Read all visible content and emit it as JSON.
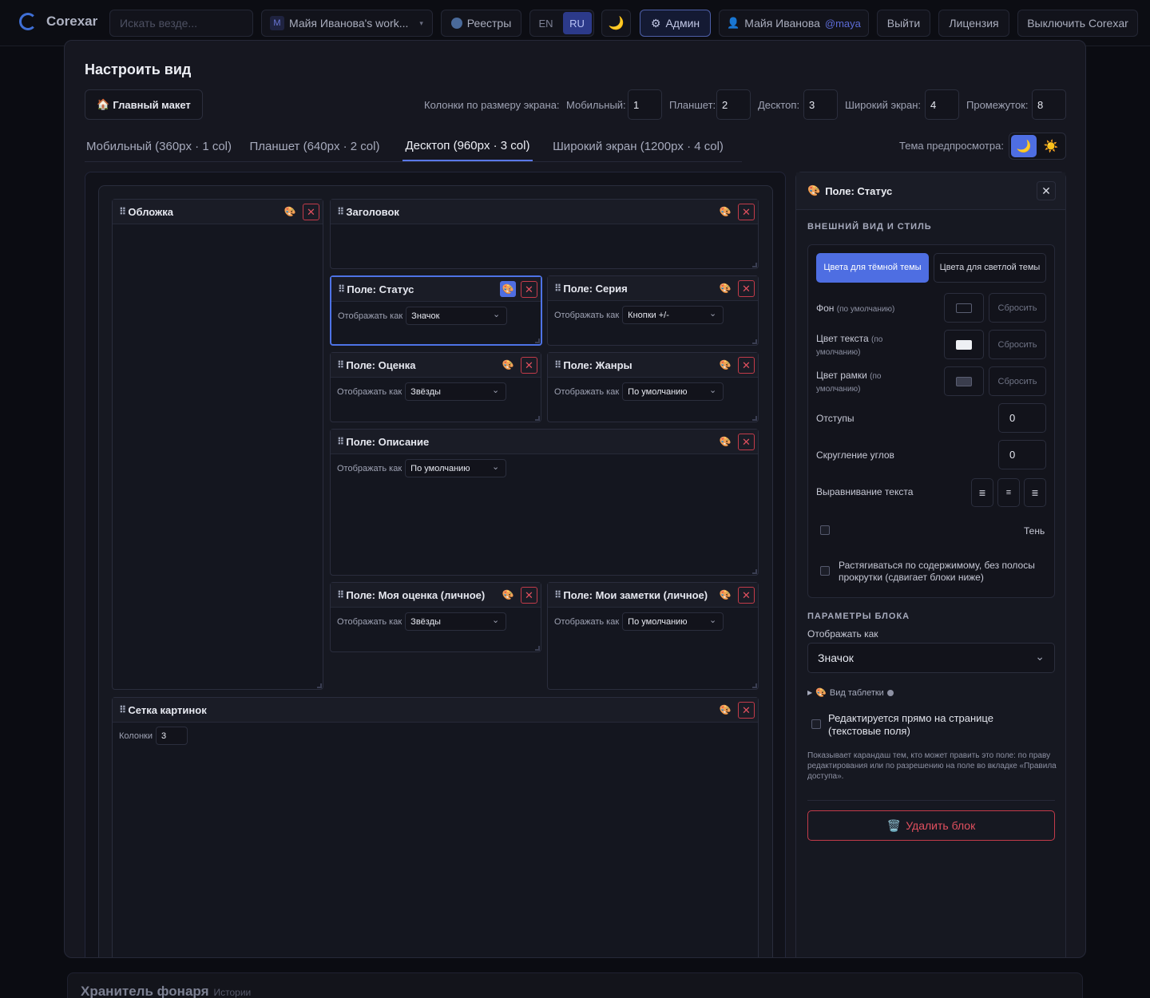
{
  "nav": {
    "brand": "Corexar",
    "search_placeholder": "Искать везде...",
    "workspace_initial": "M",
    "workspace": "Майя Иванова's work...",
    "registries": "Реестры",
    "lang_en": "EN",
    "lang_ru": "RU",
    "admin": "Админ",
    "user_name": "Майя Иванова",
    "user_handle": "@maya",
    "logout": "Выйти",
    "license": "Лицензия",
    "disable": "Выключить Corexar"
  },
  "modal": {
    "title": "Настроить вид",
    "main_layout": "Главный макет",
    "columns_label": "Колонки по размеру экрана:",
    "mobile_label": "Мобильный:",
    "mobile_value": "1",
    "tablet_label": "Планшет:",
    "tablet_value": "2",
    "desktop_label": "Десктоп:",
    "desktop_value": "3",
    "wide_label": "Широкий экран:",
    "wide_value": "4",
    "gap_label": "Промежуток:",
    "gap_value": "8",
    "tabs": [
      "Мобильный (360px · 1 col)",
      "Планшет (640px · 2 col)",
      "Десктоп (960px · 3 col)",
      "Широкий экран (1200px · 4 col)"
    ],
    "active_tab": 2,
    "preview_theme_label": "Тема предпросмотра:"
  },
  "blocks": {
    "display_as": "Отображать как",
    "cover": "Обложка",
    "header": "Заголовок",
    "status": {
      "title": "Поле: Статус",
      "value": "Значок"
    },
    "series": {
      "title": "Поле: Серия",
      "value": "Кнопки +/-"
    },
    "rating": {
      "title": "Поле: Оценка",
      "value": "Звёзды"
    },
    "genres": {
      "title": "Поле: Жанры",
      "value": "По умолчанию"
    },
    "description": {
      "title": "Поле: Описание",
      "value": "По умолчанию"
    },
    "my_rating": {
      "title": "Поле: Моя оценка (личное)",
      "value": "Звёзды"
    },
    "my_notes": {
      "title": "Поле: Мои заметки (личное)",
      "value": "По умолчанию"
    },
    "image_grid": {
      "title": "Сетка картинок",
      "columns_label": "Колонки",
      "columns_value": "3"
    }
  },
  "panel": {
    "title": "Поле: Статус",
    "appearance": "ВНЕШНИЙ ВИД И СТИЛЬ",
    "dark_colors": "Цвета для тёмной темы",
    "light_colors": "Цвета для светлой темы",
    "bg": "Фон",
    "bg_default": "(по умолчанию)",
    "text_color": "Цвет текста",
    "text_default": "(по умолчанию)",
    "border_color": "Цвет рамки",
    "border_default": "(по умолчанию)",
    "reset": "Сбросить",
    "padding": "Отступы",
    "padding_value": "0",
    "radius": "Скругление углов",
    "radius_value": "0",
    "align": "Выравнивание текста",
    "shadow": "Тень",
    "stretch": "Растягиваться по содержимому, без полосы прокрутки (сдвигает блоки ниже)",
    "block_params": "ПАРАМЕТРЫ БЛОКА",
    "display_as": "Отображать как",
    "display_value": "Значок",
    "pill_view": "Вид таблетки",
    "inline_edit": "Редактируется прямо на странице (текстовые поля)",
    "hint": "Показывает карандаш тем, кто может править это поле: по праву редактирования или по разрешению на поле во вкладке «Правила доступа».",
    "delete": "Удалить блок"
  },
  "background": {
    "title": "Хранитель фонаря",
    "subtitle": "Истории"
  },
  "colors": {
    "accent": "#4e6ee2",
    "danger": "#e2505f"
  }
}
